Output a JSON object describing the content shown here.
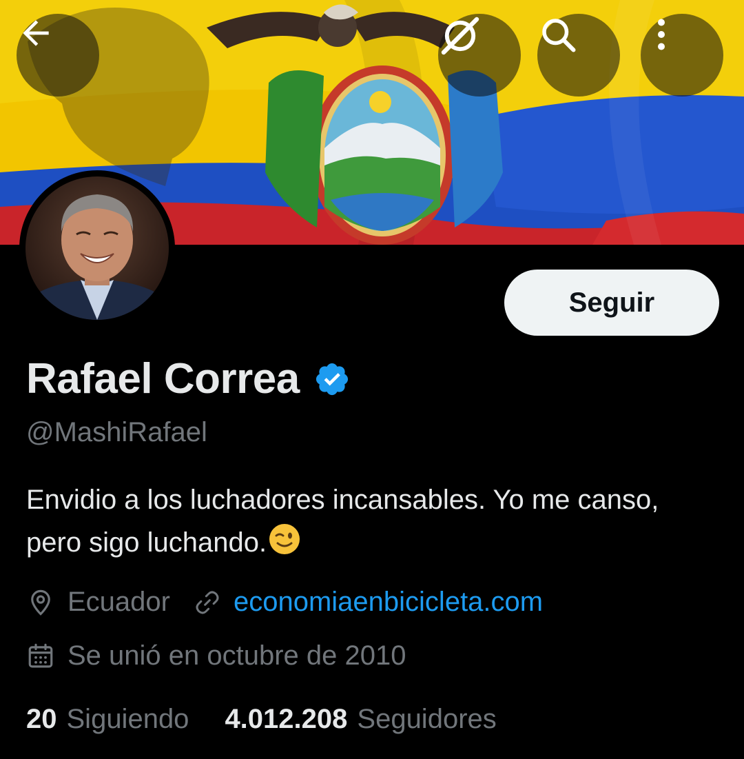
{
  "header": {
    "back_icon": "arrow-left-icon",
    "grok_icon": "slash-circle-icon",
    "search_icon": "search-icon",
    "more_icon": "more-vertical-icon"
  },
  "profile": {
    "display_name": "Rafael Correa",
    "verified": true,
    "handle": "@MashiRafael",
    "bio": "Envidio a los luchadores incansables. Yo me canso, pero sigo luchando.",
    "bio_emoji": "winking-face",
    "location": "Ecuador",
    "website": "economiaenbicicleta.com",
    "joined": "Se unió en octubre de 2010",
    "following_count": "20",
    "following_label": "Siguiendo",
    "followers_count": "4.012.208",
    "followers_label": "Seguidores"
  },
  "actions": {
    "follow_label": "Seguir"
  },
  "colors": {
    "background": "#000000",
    "text_primary": "#e7e9ea",
    "text_secondary": "#71767b",
    "link": "#1d9bf0",
    "verified_badge": "#1d9bf0",
    "follow_button_bg": "#eff3f4"
  }
}
